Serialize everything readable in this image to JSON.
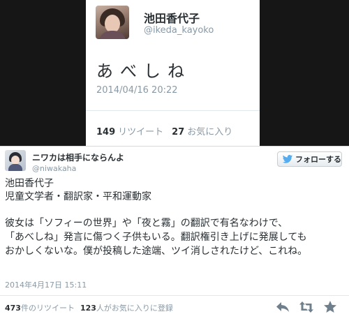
{
  "embedded": {
    "author_name": "池田香代子",
    "author_handle": "@ikeda_kayoko",
    "text": "あべしね",
    "timestamp": "2014/04/16 20:22",
    "retweet_count": "149",
    "retweet_label": "リツイート",
    "favorite_count": "27",
    "favorite_label": "お気に入り"
  },
  "tweet": {
    "author_name": "ニワカは相手にならんよ",
    "author_handle": "@niwakaha",
    "follow_label": "フォローする",
    "lines": [
      "池田香代子",
      "児童文学者・翻訳家・平和運動家",
      "彼女は「ソフィーの世界」や「夜と霧」の翻訳で有名なわけで、",
      "「あべしね」発言に傷つく子供もいる。翻訳権引き上げに発展しても",
      "おかしくないな。僕が投稿した途端、ツイ消しされたけど、これね。"
    ],
    "timestamp": "2014年4月17日 15:11",
    "retweet_count": "473",
    "retweet_suffix": "件のリツイート",
    "favorite_count": "123",
    "favorite_suffix": "人がお気に入りに登録"
  },
  "icons": {
    "follow": "twitter-bird-icon",
    "reply": "reply-icon",
    "retweet": "retweet-icon",
    "favorite": "star-icon"
  },
  "colors": {
    "brand_blue": "#55acee",
    "meta_gray": "#8899a6",
    "text_dark": "#292f33"
  }
}
